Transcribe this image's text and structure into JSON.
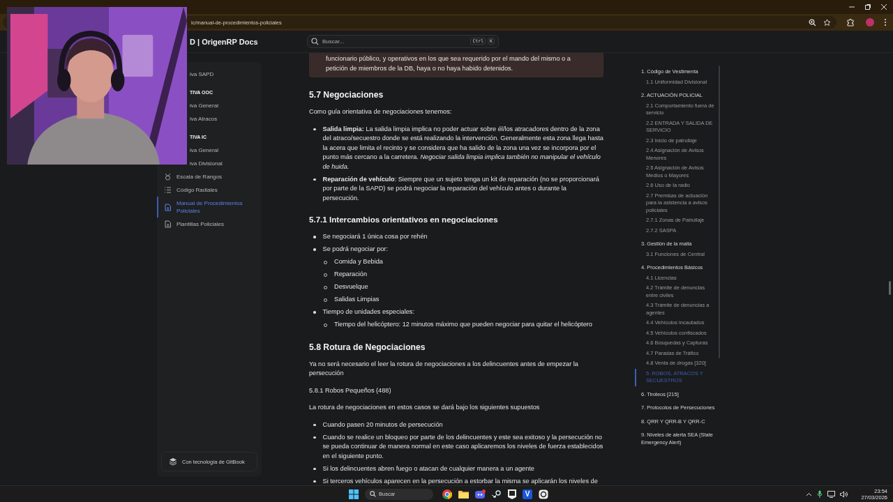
{
  "browser": {
    "url": "ic/manual-de-procedimientos-policiales"
  },
  "site": {
    "title": "D | OrigenRP Docs",
    "search": {
      "placeholder": "Buscar...",
      "keys": [
        "Ctrl",
        "K"
      ]
    }
  },
  "sidebar": {
    "items": [
      {
        "label": "iva SAPD",
        "kind": "partial",
        "selected": false
      },
      {
        "label": "TIVA OOC",
        "kind": "heading",
        "selected": false
      },
      {
        "label": "iva General",
        "kind": "partial",
        "selected": false
      },
      {
        "label": "iva Atracos",
        "kind": "partial",
        "selected": false
      },
      {
        "label": "TIVA IC",
        "kind": "heading",
        "selected": false
      },
      {
        "label": "iva General",
        "kind": "partial",
        "selected": false
      },
      {
        "label": "iva Divisional",
        "kind": "partial",
        "selected": false
      },
      {
        "label": "Escala de Rangos",
        "kind": "medal",
        "selected": false
      },
      {
        "label": "Código Radiales",
        "kind": "list",
        "selected": false
      },
      {
        "label": "Manual de Procedimientos Policiales",
        "kind": "doc",
        "selected": true
      },
      {
        "label": "Plantillas Policiales",
        "kind": "doc",
        "selected": false
      }
    ],
    "footer": "Con tecnología de GitBook"
  },
  "article": {
    "callout": "funcionario público, y operativos en los que sea requerido por el mando del mismo o a petición de miembros de la DB, haya o no haya habido detenidos.",
    "blocks": [
      {
        "kind": "h2",
        "text": "5.7 Negociaciones"
      },
      {
        "kind": "p",
        "text": "Como guía orientativa de negociaciones tenemos:"
      },
      {
        "kind": "ul",
        "items": [
          {
            "text": "**Salida limpia:** La salida limpia implica no poder actuar sobre él/los atracadores dentro de la zona del atraco/secuestro donde se está realizando la intervención. Generalmente esta zona llega hasta la acera que limita el recinto y se considera que ha salido de la zona una vez se incorpora por el punto más cercano a la carretera. *Negociar salida limpia implica también no manipular el vehículo de huida.*"
          },
          {
            "text": "**Reparación de vehículo**: Siempre que un sujeto tenga un kit de reparación (no se proporcionará por parte de la SAPD) se podrá negociar la reparación del vehículo antes o durante la persecución."
          }
        ]
      },
      {
        "kind": "h3",
        "text": "5.7.1 Intercambios orientativos en negociaciones"
      },
      {
        "kind": "ul",
        "items": [
          {
            "text": "Se negociará 1 única cosa por rehén"
          },
          {
            "text": "Se podrá negociar por:",
            "children": [
              {
                "text": "Comida y Bebida"
              },
              {
                "text": "Reparación"
              },
              {
                "text": "Desvuelque"
              },
              {
                "text": "Salidas Limpias"
              }
            ]
          },
          {
            "text": "Tiempo de unidades especiales:",
            "children": [
              {
                "text": "Tiempo del helicóptero: 12 minutos máximo que pueden negociar para quitar el helicóptero"
              }
            ]
          }
        ]
      },
      {
        "kind": "h2",
        "text": "5.8 Rotura de Negociaciones"
      },
      {
        "kind": "p",
        "text": "Ya no será necesario el leer la rotura de negociaciones a los delincuentes antes de empezar la persecución"
      },
      {
        "kind": "p",
        "text": "5.8.1 Robos Pequeños (488)"
      },
      {
        "kind": "p",
        "text": "La rotura de negociaciones en estos casos se dará bajo los siguientes supuestos"
      },
      {
        "kind": "ul",
        "items": [
          {
            "text": "Cuando pasen 20 minutos de persecución"
          },
          {
            "text": "Cuando se realice un bloqueo por parte de los delincuentes y este sea exitoso y la persecución no se pueda continuar de manera normal en este caso aplicaremos los niveles de fuerza establecidos en el siguiente punto."
          },
          {
            "text": "Si los delincuentes abren fuego o atacan de cualquier manera a un agente"
          },
          {
            "text": "Si terceros vehículos aparecen en la persecución a estorbar la misma se aplicarán los niveles de"
          }
        ]
      }
    ]
  },
  "toc": {
    "items": [
      {
        "label": "1. Código de Vestimenta",
        "selected": false,
        "children": [
          {
            "label": "1.1 Uniformidad Divisional",
            "selected": false
          }
        ]
      },
      {
        "label": "2. ACTUACIÓN POLICIAL",
        "selected": false,
        "children": [
          {
            "label": "2.1 Comportamiento fuera de servicio",
            "selected": false
          },
          {
            "label": "2.2 ENTRADA Y SALIDA DE SERVICIO",
            "selected": false
          },
          {
            "label": "2.3 Inicio de patrullaje",
            "selected": false
          },
          {
            "label": "2.4 Asignación de Avisos Menores",
            "selected": false
          },
          {
            "label": "2.5 Asignación de Avisos Medios o Mayores",
            "selected": false
          },
          {
            "label": "2.6 Uso de la radio",
            "selected": false
          },
          {
            "label": "2.7 Premisas de actuación para la asistencia a avisos policiales",
            "selected": false
          },
          {
            "label": "2.7.1 Zonas de Patrullaje",
            "selected": false
          },
          {
            "label": "2.7.2 SASPA",
            "selected": false
          }
        ]
      },
      {
        "label": "3. Gestión de la malla",
        "selected": false,
        "children": [
          {
            "label": "3.1 Funciones de Central",
            "selected": false
          }
        ]
      },
      {
        "label": "4. Procedimientos Básicos",
        "selected": false,
        "children": [
          {
            "label": "4.1 Licencias",
            "selected": false
          },
          {
            "label": "4.2 Trámite de denuncias entre civiles",
            "selected": false
          },
          {
            "label": "4.3 Trámite de denuncias a agentes",
            "selected": false
          },
          {
            "label": "4.4 Vehículos incautados",
            "selected": false
          },
          {
            "label": "4.5 Vehículos confiscados",
            "selected": false
          },
          {
            "label": "4.6 Búsquedas y Capturas",
            "selected": false
          },
          {
            "label": "4.7 Paradas de Tráfico",
            "selected": false
          },
          {
            "label": "4.8 Venta de drogas [320]",
            "selected": false
          },
          {
            "label": "5. ROBOS, ATRACOS Y SECUESTROS",
            "selected": true
          }
        ]
      },
      {
        "label": "6. Tiroteos [215]",
        "selected": false
      },
      {
        "label": "7. Protocolos de Persecuciones",
        "selected": false
      },
      {
        "label": "8. QRR Y QRR-B Y QRR-C",
        "selected": false
      },
      {
        "label": "9. Niveles de alerta SEA (State Emergency Alert)",
        "selected": false
      }
    ]
  },
  "taskbar": {
    "search": {
      "placeholder": "Buscar"
    },
    "apps": [
      {
        "kind": "browser"
      },
      {
        "kind": "folder"
      },
      {
        "kind": "chat"
      },
      {
        "kind": "steam"
      },
      {
        "kind": "store"
      },
      {
        "kind": "letter",
        "glyph": "V"
      },
      {
        "kind": "app"
      }
    ],
    "clock": {
      "time": "23:54",
      "date": "27/03/2026"
    }
  }
}
